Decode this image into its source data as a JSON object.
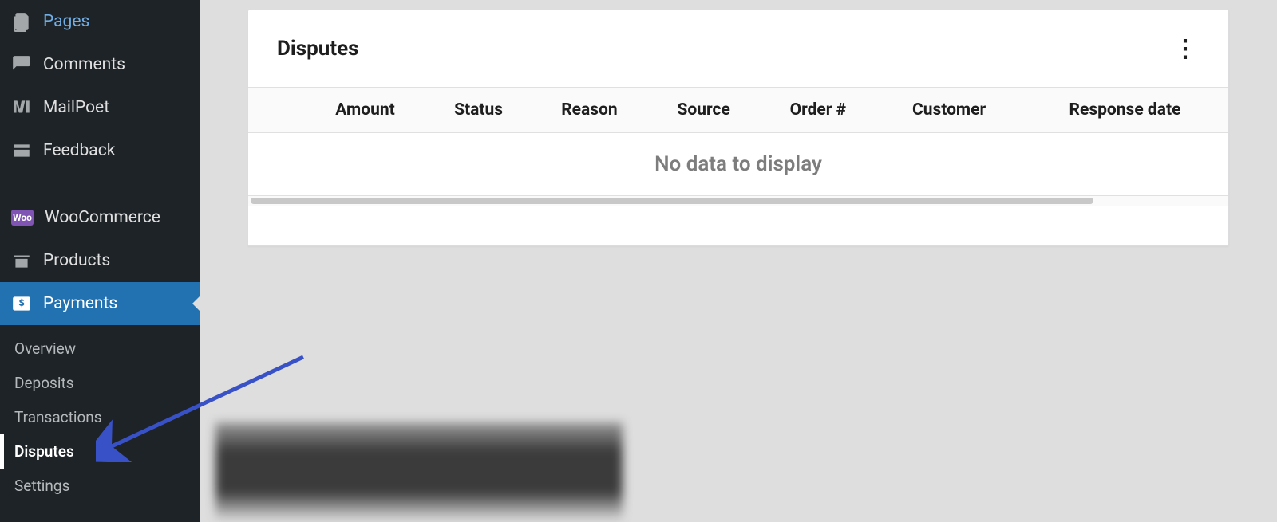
{
  "sidebar": {
    "items": [
      {
        "id": "pages",
        "label": "Pages"
      },
      {
        "id": "comments",
        "label": "Comments"
      },
      {
        "id": "mailpoet",
        "label": "MailPoet"
      },
      {
        "id": "feedback",
        "label": "Feedback"
      },
      {
        "id": "woocommerce",
        "label": "WooCommerce",
        "badge": "Woo"
      },
      {
        "id": "products",
        "label": "Products"
      },
      {
        "id": "payments",
        "label": "Payments",
        "active": true
      }
    ],
    "submenu": [
      {
        "id": "overview",
        "label": "Overview"
      },
      {
        "id": "deposits",
        "label": "Deposits"
      },
      {
        "id": "transactions",
        "label": "Transactions"
      },
      {
        "id": "disputes",
        "label": "Disputes",
        "current": true
      },
      {
        "id": "settings",
        "label": "Settings"
      }
    ]
  },
  "panel": {
    "title": "Disputes",
    "empty_message": "No data to display",
    "columns": [
      "Amount",
      "Status",
      "Reason",
      "Source",
      "Order #",
      "Customer",
      "Response date"
    ]
  }
}
